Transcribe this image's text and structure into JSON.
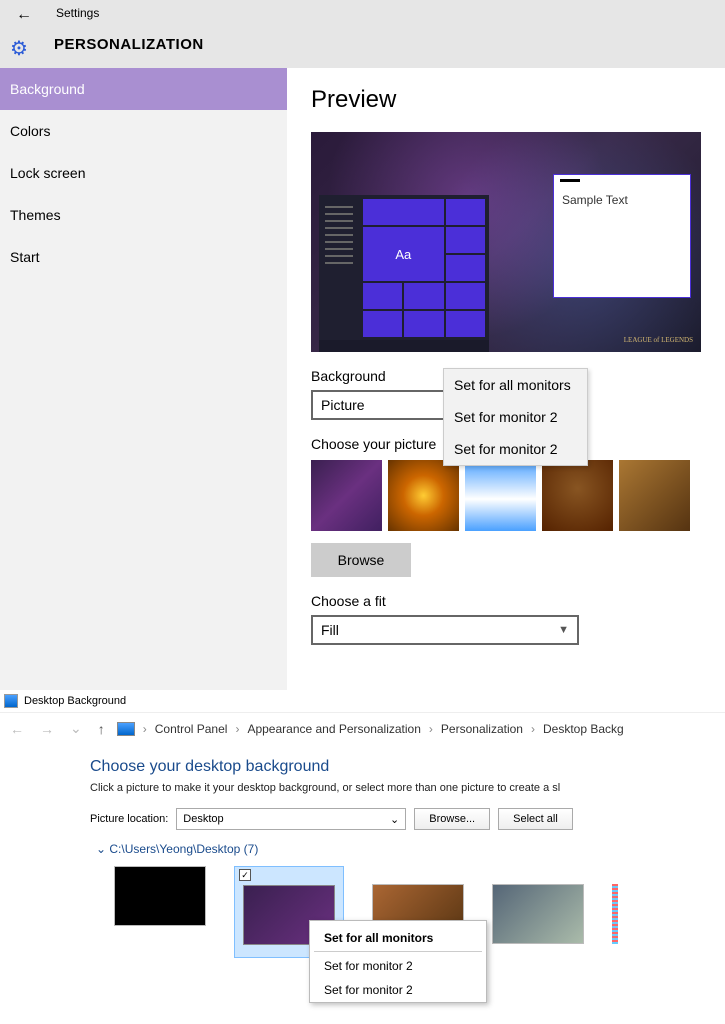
{
  "settings": {
    "back": "←",
    "title": "Settings",
    "section": "PERSONALIZATION",
    "sidebar": [
      {
        "label": "Background",
        "active": true
      },
      {
        "label": "Colors",
        "active": false
      },
      {
        "label": "Lock screen",
        "active": false
      },
      {
        "label": "Themes",
        "active": false
      },
      {
        "label": "Start",
        "active": false
      }
    ],
    "preview_heading": "Preview",
    "sample_text": "Sample Text",
    "aa": "Aa",
    "bg_label": "Background",
    "bg_value": "Picture",
    "choose_pic": "Choose your picture",
    "browse": "Browse",
    "fit_label": "Choose a fit",
    "fit_value": "Fill",
    "preview_logo": "LEAGUE of LEGENDS",
    "context_menu": [
      "Set for all monitors",
      "Set for monitor 2",
      "Set for monitor 2"
    ]
  },
  "cp": {
    "window_title": "Desktop Background",
    "breadcrumb": [
      "Control Panel",
      "Appearance and Personalization",
      "Personalization",
      "Desktop Backg"
    ],
    "heading": "Choose your desktop background",
    "sub": "Click a picture to make it your desktop background, or select more than one picture to create a sl",
    "loc_label": "Picture location:",
    "loc_value": "Desktop",
    "browse": "Browse...",
    "select_all": "Select all",
    "folder": "C:\\Users\\Yeong\\Desktop (7)",
    "check": "✓",
    "context_menu": {
      "header": "Set for all monitors",
      "items": [
        "Set for monitor 2",
        "Set for monitor 2"
      ]
    }
  }
}
